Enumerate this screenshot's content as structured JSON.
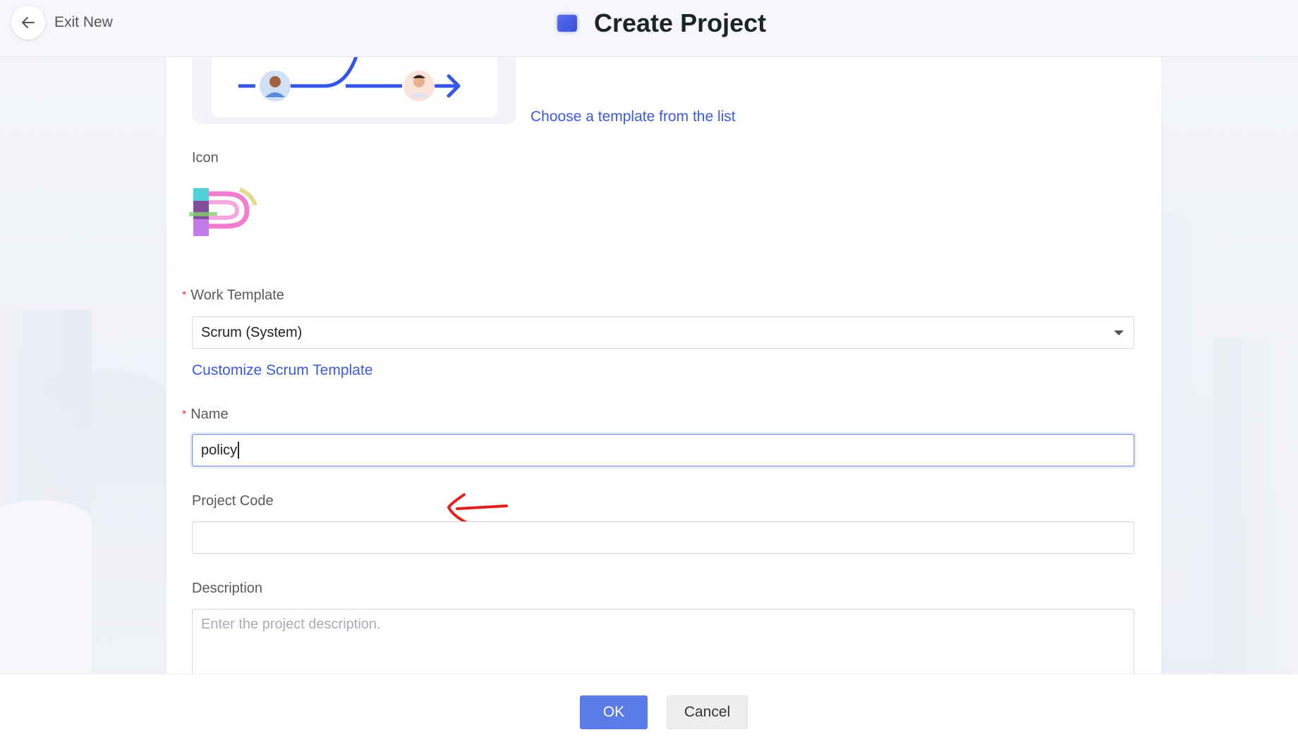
{
  "header": {
    "exit_label": "Exit New",
    "title": "Create Project",
    "back_icon": "arrow-left-icon",
    "title_icon": "project-icon"
  },
  "form": {
    "template_link": "Choose a template from the list",
    "icon_label": "Icon",
    "work_template": {
      "label": "Work Template",
      "value": "Scrum (System)",
      "required": true
    },
    "customize_link": "Customize Scrum Template",
    "name": {
      "label": "Name",
      "value": "policy",
      "required": true
    },
    "project_code": {
      "label": "Project Code",
      "value": ""
    },
    "description": {
      "label": "Description",
      "placeholder": "Enter the project description."
    },
    "required_marker": "*"
  },
  "footer": {
    "ok_label": "OK",
    "cancel_label": "Cancel"
  },
  "colors": {
    "accent": "#3b5bdb",
    "primary_button": "#5b7be8",
    "required": "#e03131",
    "annotation": "#e02020"
  }
}
